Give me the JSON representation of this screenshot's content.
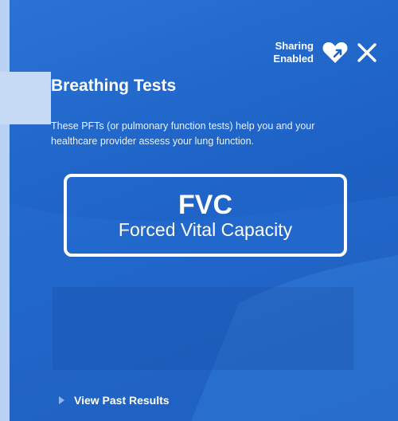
{
  "header": {
    "sharing_line1": "Sharing",
    "sharing_line2": "Enabled",
    "share_icon": "heart-share-icon",
    "close_icon": "close-icon"
  },
  "main": {
    "title": "Breathing Tests",
    "description": "These PFTs (or pulmonary function tests) help you and your healthcare provider assess your lung function.",
    "test": {
      "abbr": "FVC",
      "name": "Forced Vital Capacity"
    },
    "past_results_label": "View Past Results"
  },
  "colors": {
    "panel_blue": "#1e62c6",
    "text": "#ffffff",
    "caret": "#8fb6ec"
  }
}
